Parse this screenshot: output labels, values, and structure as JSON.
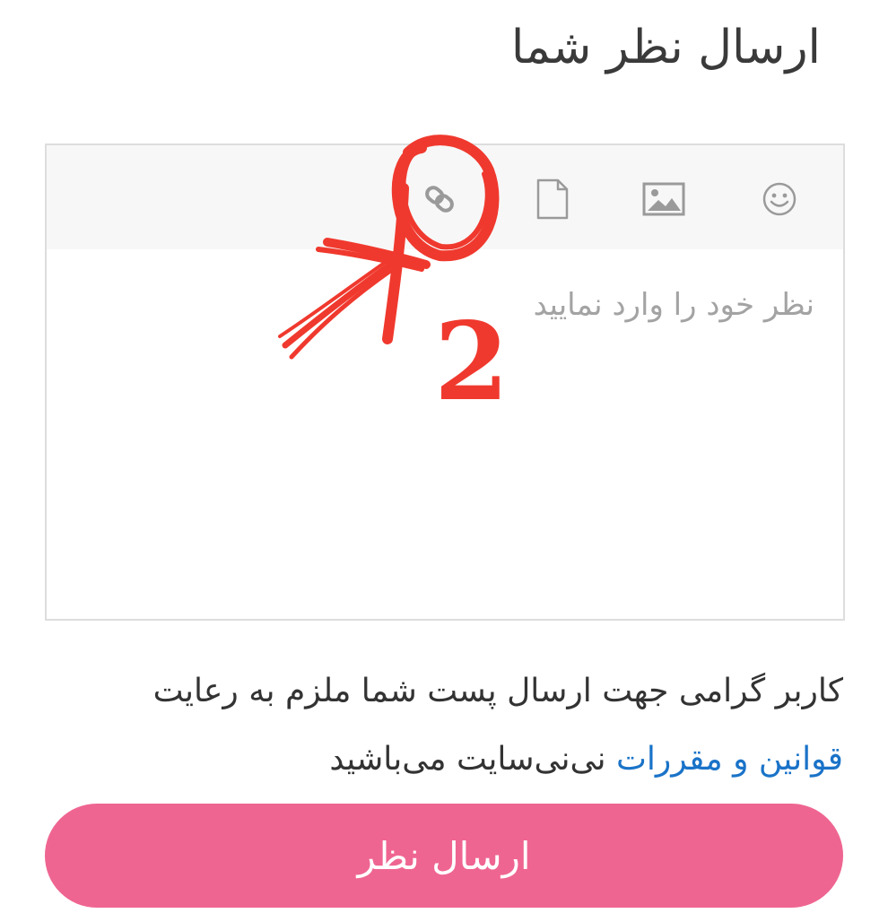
{
  "header": {
    "title": "ارسال نظر شما"
  },
  "editor": {
    "placeholder": "نظر خود را وارد نمایید",
    "toolbar": [
      {
        "icon": "smiley-icon",
        "label": ""
      },
      {
        "icon": "image-icon",
        "label": ""
      },
      {
        "icon": "file-icon",
        "label": ""
      },
      {
        "icon": "link-icon",
        "label": ""
      }
    ]
  },
  "annotation": {
    "number": "2",
    "color": "#f0392e"
  },
  "rules": {
    "line1": "کاربر گرامی جهت ارسال پست شما ملزم به رعایت",
    "link_text": "قوانین و مقررات",
    "line2_rest": " نی‌نی‌سایت می‌باشید"
  },
  "submit": {
    "label": "ارسال نظر",
    "color": "#ef6591"
  }
}
